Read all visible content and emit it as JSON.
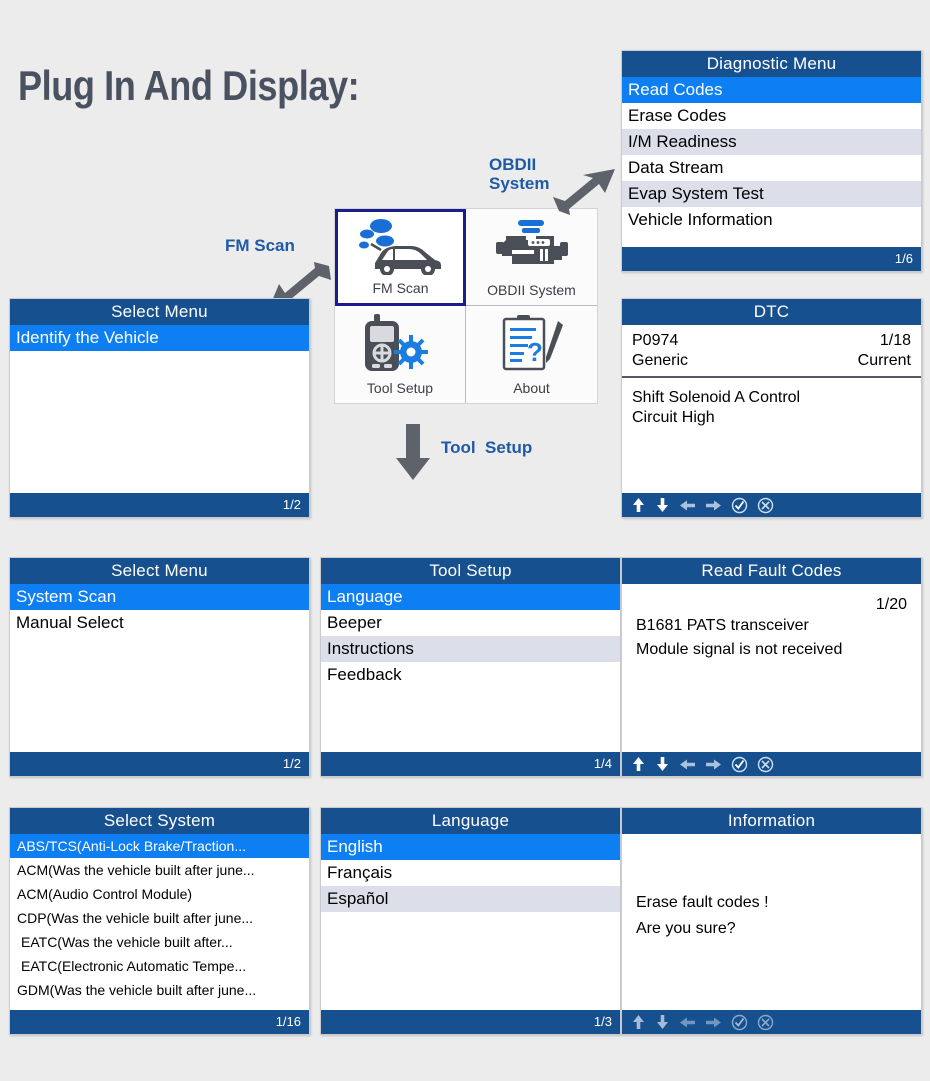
{
  "title": "Plug In And Display:",
  "annotations": {
    "fm_scan": "FM Scan",
    "obdii_system": "OBDII\nSystem",
    "tool_setup": "Tool  Setup"
  },
  "tile_grid": {
    "tiles": [
      {
        "label": "FM Scan",
        "icon": "car-smoke-icon",
        "selected": true
      },
      {
        "label": "OBDII System",
        "icon": "engine-icon",
        "selected": false
      },
      {
        "label": "Tool Setup",
        "icon": "scanner-gear-icon",
        "selected": false
      },
      {
        "label": "About",
        "icon": "clipboard-pencil-icon",
        "selected": false
      }
    ]
  },
  "panels": {
    "diagnostic_menu": {
      "title": "Diagnostic Menu",
      "page": "1/6",
      "items": [
        {
          "label": "Read Codes",
          "selected": true
        },
        {
          "label": "Erase Codes",
          "selected": false
        },
        {
          "label": "I/M Readiness",
          "selected": false
        },
        {
          "label": "Data Stream",
          "selected": false
        },
        {
          "label": "Evap System Test",
          "selected": false
        },
        {
          "label": "Vehicle Information",
          "selected": false
        }
      ]
    },
    "dtc": {
      "title": "DTC",
      "code": "P0974",
      "code_type": "Generic",
      "page": "1/18",
      "status": "Current",
      "description_line1": "Shift  Solenoid A Control",
      "description_line2": "Circuit High",
      "nav_icons": [
        "up-arrow-icon",
        "down-arrow-icon",
        "left-arrow-icon",
        "right-arrow-icon",
        "check-circle-icon",
        "close-circle-icon"
      ]
    },
    "select_menu_vehicle": {
      "title": "Select Menu",
      "page": "1/2",
      "items": [
        {
          "label": "Identify the Vehicle",
          "selected": true
        }
      ]
    },
    "select_menu_scan": {
      "title": "Select Menu",
      "page": "1/2",
      "items": [
        {
          "label": "System Scan",
          "selected": true
        },
        {
          "label": "Manual Select",
          "selected": false
        }
      ]
    },
    "tool_setup": {
      "title": "Tool Setup",
      "page": "1/4",
      "items": [
        {
          "label": "Language",
          "selected": true
        },
        {
          "label": "Beeper",
          "selected": false
        },
        {
          "label": "Instructions",
          "selected": false
        },
        {
          "label": "Feedback",
          "selected": false
        }
      ]
    },
    "read_fault_codes": {
      "title": "Read Fault Codes",
      "page": "1/20",
      "line1": "B1681 PATS transceiver",
      "line2": "Module signal is not received",
      "nav_icons": [
        "up-arrow-icon",
        "down-arrow-icon",
        "left-arrow-icon",
        "right-arrow-icon",
        "check-circle-icon",
        "close-circle-icon"
      ]
    },
    "select_system": {
      "title": "Select System",
      "page": "1/16",
      "items": [
        {
          "label": "ABS/TCS(Anti-Lock Brake/Traction...",
          "selected": true
        },
        {
          "label": "ACM(Was the vehicle built after june...",
          "selected": false
        },
        {
          "label": "ACM(Audio Control Module)",
          "selected": false
        },
        {
          "label": "CDP(Was the vehicle built after june...",
          "selected": false
        },
        {
          "label": "EATC(Was the vehicle built after...",
          "selected": false
        },
        {
          "label": "EATC(Electronic Automatic Tempe...",
          "selected": false
        },
        {
          "label": "GDM(Was the vehicle built after june...",
          "selected": false
        }
      ]
    },
    "language": {
      "title": "Language",
      "page": "1/3",
      "items": [
        {
          "label": "English",
          "selected": true
        },
        {
          "label": "Français",
          "selected": false
        },
        {
          "label": "Español",
          "selected": false
        }
      ]
    },
    "information": {
      "title": "Information",
      "line1": "Erase fault codes !",
      "line2": "Are you sure?",
      "nav_icons": [
        "up-arrow-icon",
        "down-arrow-icon",
        "left-arrow-icon",
        "right-arrow-icon",
        "check-circle-icon",
        "close-circle-icon"
      ]
    }
  },
  "colors": {
    "header_blue": "#17508f",
    "selected_blue": "#0d7ff2",
    "alt_row": "#dcdeea",
    "annotation_blue": "#1f5aa6",
    "title_gray": "#4a5160",
    "arrow_gray": "#5e636b",
    "background": "#ececec"
  }
}
